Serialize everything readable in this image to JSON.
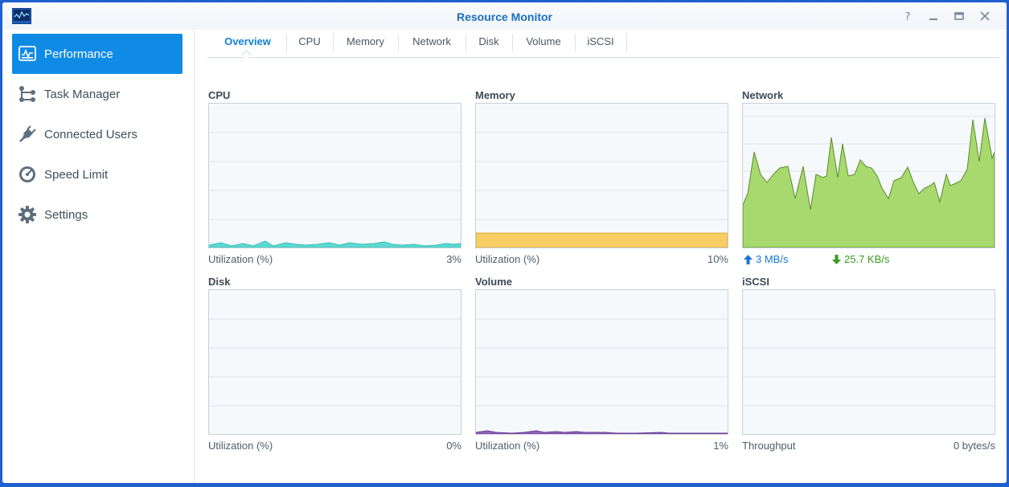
{
  "window": {
    "title": "Resource Monitor"
  },
  "sidebar": {
    "items": [
      {
        "label": "Performance",
        "icon": "performance-icon",
        "active": true
      },
      {
        "label": "Task Manager",
        "icon": "task-manager-icon"
      },
      {
        "label": "Connected Users",
        "icon": "plug-icon"
      },
      {
        "label": "Speed Limit",
        "icon": "speedometer-icon"
      },
      {
        "label": "Settings",
        "icon": "gear-icon"
      }
    ]
  },
  "tabs": [
    {
      "label": "Overview",
      "active": true
    },
    {
      "label": "CPU"
    },
    {
      "label": "Memory"
    },
    {
      "label": "Network"
    },
    {
      "label": "Disk"
    },
    {
      "label": "Volume"
    },
    {
      "label": "iSCSI"
    }
  ],
  "panels": {
    "cpu": {
      "title": "CPU",
      "metric": "Utilization (%)",
      "value": "3%",
      "color": "#4fd2cc"
    },
    "memory": {
      "title": "Memory",
      "metric": "Utilization (%)",
      "value": "10%",
      "color": "#f7cd62"
    },
    "network": {
      "title": "Network",
      "upload": "3 MB/s",
      "download": "25.7 KB/s",
      "color": "#a6d86a"
    },
    "disk": {
      "title": "Disk",
      "metric": "Utilization (%)",
      "value": "0%"
    },
    "volume": {
      "title": "Volume",
      "metric": "Utilization (%)",
      "value": "1%",
      "color": "#8a5db0"
    },
    "iscsi": {
      "title": "iSCSI",
      "metric": "Throughput",
      "value": "0 bytes/s"
    }
  },
  "colors": {
    "accent": "#0f8be6",
    "title": "#1a6fc4",
    "upload": "#1a76cf",
    "download": "#3a9b1e"
  }
}
